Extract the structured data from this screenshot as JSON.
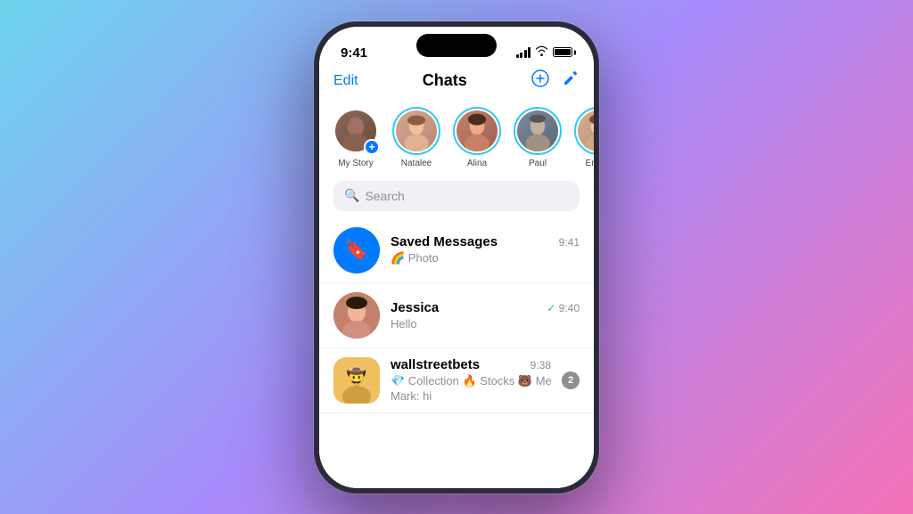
{
  "background": {
    "gradient": "135deg, #6dd5ed 0%, #a78bfa 50%, #f472b6 100%"
  },
  "phone": {
    "status_bar": {
      "time": "9:41"
    },
    "header": {
      "edit_label": "Edit",
      "title": "Chats",
      "add_icon": "➕",
      "compose_icon": "✏️"
    },
    "stories": [
      {
        "name": "My Story",
        "has_plus": true,
        "ring": false,
        "avatar_class": "avatar-my-story"
      },
      {
        "name": "Natalee",
        "has_plus": false,
        "ring": true,
        "avatar_class": "avatar-natalee"
      },
      {
        "name": "Alina",
        "has_plus": false,
        "ring": true,
        "avatar_class": "avatar-alina"
      },
      {
        "name": "Paul",
        "has_plus": false,
        "ring": true,
        "avatar_class": "avatar-paul"
      },
      {
        "name": "Emma",
        "has_plus": false,
        "ring": true,
        "avatar_class": "avatar-emma"
      }
    ],
    "search": {
      "placeholder": "Search"
    },
    "chats": [
      {
        "id": "saved",
        "name": "Saved Messages",
        "preview": "🌈 Photo",
        "time": "9:41",
        "avatar_type": "saved",
        "unread": null,
        "check": null
      },
      {
        "id": "jessica",
        "name": "Jessica",
        "preview": "Hello",
        "time": "9:40",
        "avatar_type": "jessica",
        "unread": null,
        "check": "✓"
      },
      {
        "id": "wsb",
        "name": "wallstreetbets",
        "preview": "💎 Collection 🔥 Stocks 🐻 Memes...",
        "preview_sub": "Mark: hi",
        "time": "9:38",
        "avatar_type": "wsb",
        "unread": "2",
        "check": null
      }
    ]
  }
}
